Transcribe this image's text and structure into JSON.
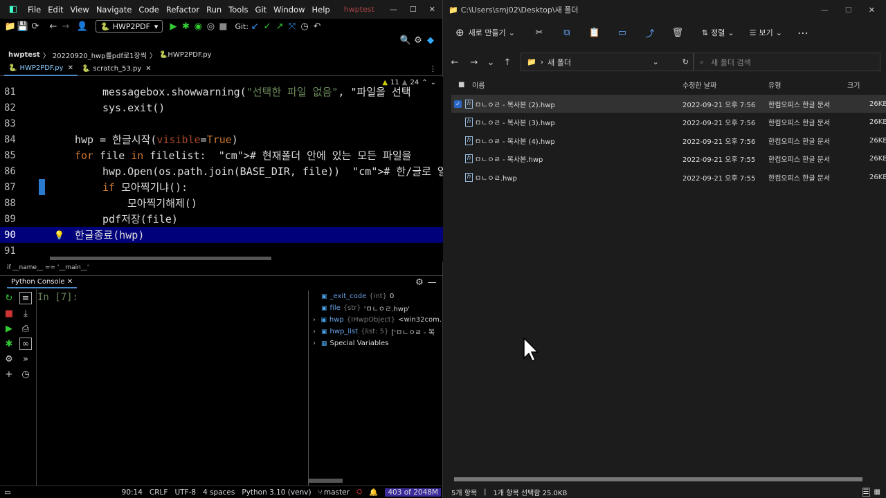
{
  "ide": {
    "menu": [
      "File",
      "Edit",
      "View",
      "Navigate",
      "Code",
      "Refactor",
      "Run",
      "Tools",
      "Git",
      "Window",
      "Help"
    ],
    "app_name": "hwptest",
    "run_config": "HWP2PDF",
    "git_label": "Git:",
    "breadcrumb": [
      "hwptest",
      "20220920_hwp를pdf로1장씩",
      "HWP2PDF.py"
    ],
    "tabs": [
      "HWP2PDF.py",
      "scratch_53.py"
    ],
    "inspections": {
      "warnings": "11",
      "weak": "24"
    },
    "lines": [
      {
        "n": "81",
        "code": "messagebox.showwarning(\"선택한 파일 없음\", \"파일을 선택"
      },
      {
        "n": "82",
        "code": "sys.exit()"
      },
      {
        "n": "83",
        "code": ""
      },
      {
        "n": "84",
        "code": "hwp = 한글시작(visible=True)"
      },
      {
        "n": "85",
        "code": "for file in filelist:  # 현재폴더 안에 있는 모든 파일을"
      },
      {
        "n": "86",
        "code": "hwp.Open(os.path.join(BASE_DIR, file))  # 한/글로 열어서"
      },
      {
        "n": "87",
        "code": "if 모아찍기냐():"
      },
      {
        "n": "88",
        "code": "모아찍기해제()"
      },
      {
        "n": "89",
        "code": "pdf저장(file)"
      },
      {
        "n": "90",
        "code": "한글종료(hwp)"
      },
      {
        "n": "91",
        "code": ""
      }
    ],
    "scroll_context": "if __name__ == '__main__'",
    "console_title": "Python Console",
    "console_prompt": "In [7]:",
    "variables": [
      {
        "name": "_exit_code",
        "type": "{int}",
        "value": "0"
      },
      {
        "name": "file",
        "type": "{str}",
        "value": "'ㅁㄴㅇㄹ.hwp'"
      },
      {
        "name": "hwp",
        "type": "{IHwpObject}",
        "value": "<win32com."
      },
      {
        "name": "hwp_list",
        "type": "{list: 5}",
        "value": "['ㅁㄴㅇㄹ - 복"
      },
      {
        "name": "Special Variables",
        "type": "",
        "value": ""
      }
    ],
    "status": {
      "pos": "90:14",
      "eol": "CRLF",
      "enc": "UTF-8",
      "indent": "4 spaces",
      "interp": "Python 3.10 (venv)",
      "branch": "master",
      "mem": "403 of 2048M"
    }
  },
  "explorer": {
    "path": "C:\\Users\\smj02\\Desktop\\새 폴더",
    "new_label": "새로 만들기",
    "sort_label": "정렬",
    "view_label": "보기",
    "address": "새 폴더",
    "search_placeholder": "새 폴더 검색",
    "columns": [
      "이름",
      "수정한 날짜",
      "유형",
      "크기"
    ],
    "files": [
      {
        "name": "ㅁㄴㅇㄹ - 복사본 (2).hwp",
        "date": "2022-09-21 오후 7:56",
        "type": "한컴오피스 한글 문서",
        "size": "26KB",
        "selected": true
      },
      {
        "name": "ㅁㄴㅇㄹ - 복사본 (3).hwp",
        "date": "2022-09-21 오후 7:56",
        "type": "한컴오피스 한글 문서",
        "size": "26KB",
        "selected": false
      },
      {
        "name": "ㅁㄴㅇㄹ - 복사본 (4).hwp",
        "date": "2022-09-21 오후 7:56",
        "type": "한컴오피스 한글 문서",
        "size": "26KB",
        "selected": false
      },
      {
        "name": "ㅁㄴㅇㄹ - 복사본.hwp",
        "date": "2022-09-21 오후 7:55",
        "type": "한컴오피스 한글 문서",
        "size": "26KB",
        "selected": false
      },
      {
        "name": "ㅁㄴㅇㄹ.hwp",
        "date": "2022-09-21 오후 7:55",
        "type": "한컴오피스 한글 문서",
        "size": "26KB",
        "selected": false
      }
    ],
    "status_count": "5개 항목",
    "status_sel": "1개 항목 선택함 25.0KB"
  }
}
